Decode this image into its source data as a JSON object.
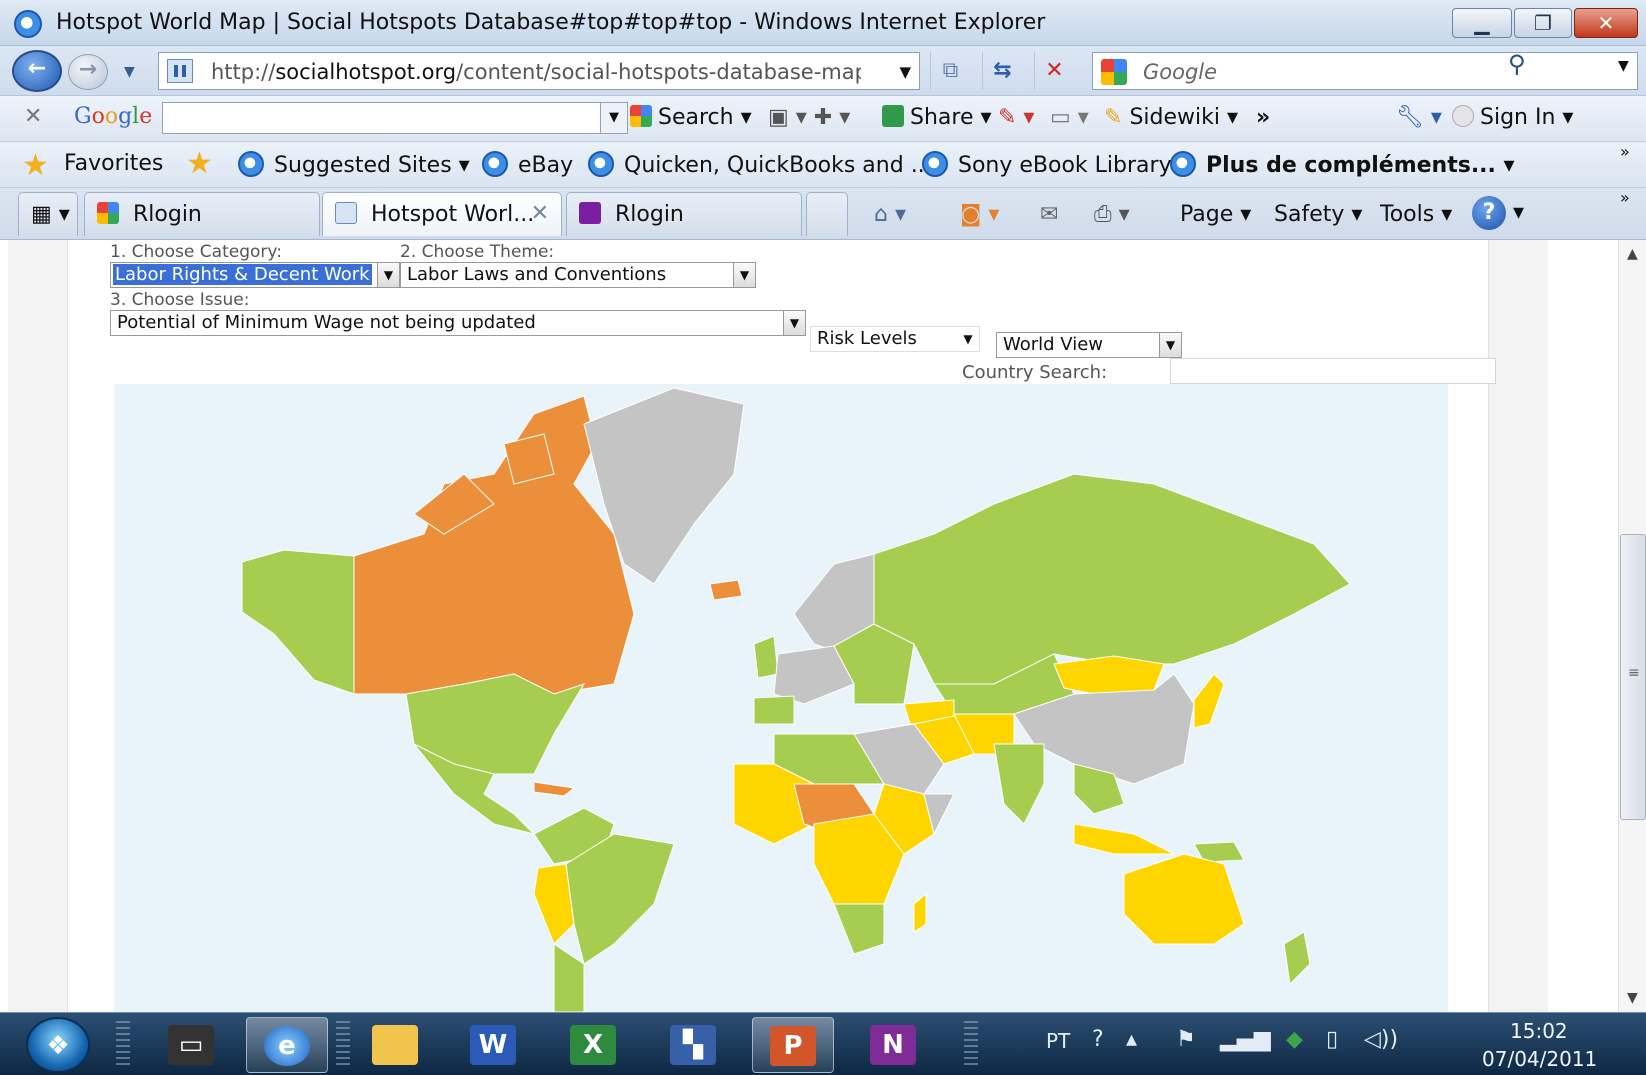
{
  "window": {
    "title": "Hotspot World Map | Social Hotspots Database#top#top#top - Windows Internet Explorer",
    "minimize": "▁",
    "restore": "❐",
    "close": "✕"
  },
  "address_bar": {
    "url_prefix": "http://",
    "url_domain": "socialhotspot.org",
    "url_path": "/content/social-hotspots-database-map",
    "search_placeholder": "Google"
  },
  "google_toolbar": {
    "close": "✕",
    "logo": [
      "G",
      "o",
      "o",
      "g",
      "l",
      "e"
    ],
    "search_label": "Search",
    "share_label": "Share",
    "sidewiki_label": "Sidewiki",
    "more": "»",
    "sign_in": "Sign In"
  },
  "favorites_bar": {
    "favorites": "Favorites",
    "items": [
      "Suggested Sites",
      "eBay",
      "Quicken, QuickBooks and ...",
      "Sony eBook Library",
      "Plus de compléments..."
    ]
  },
  "tabs": [
    {
      "label": "Rlogin",
      "active": false
    },
    {
      "label": "Hotspot Worl...",
      "active": true
    },
    {
      "label": "Rlogin",
      "active": false
    }
  ],
  "command_bar": {
    "page": "Page",
    "safety": "Safety",
    "tools": "Tools"
  },
  "form": {
    "category_label": "1. Choose Category:",
    "category_value": "Labor Rights & Decent Work",
    "theme_label": "2. Choose Theme:",
    "theme_value": "Labor Laws and Conventions",
    "issue_label": "3. Choose Issue:",
    "issue_value": "Potential of Minimum Wage not being updated",
    "risk_levels": "Risk Levels",
    "view": "World View",
    "country_search_label": "Country Search:"
  },
  "map_colors": {
    "ocean": "#e8f4fa",
    "low": "#a6cd4f",
    "medium": "#ffd500",
    "high": "#ec8f3a",
    "no_data": "#c4c4c4"
  },
  "taskbar": {
    "language": "PT",
    "time": "15:02",
    "date": "07/04/2011",
    "apps": [
      "laptop",
      "internet-explorer",
      "file-explorer",
      "word",
      "excel",
      "app",
      "powerpoint",
      "onenote"
    ]
  }
}
